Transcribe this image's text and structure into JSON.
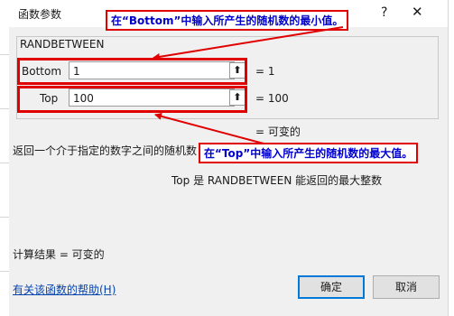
{
  "dialog": {
    "title": "函数参数",
    "help_glyph": "?",
    "close_glyph": "✕"
  },
  "function": {
    "name": "RANDBETWEEN",
    "args": [
      {
        "label": "Bottom",
        "value": "1",
        "result": "=  1"
      },
      {
        "label": "Top",
        "value": "100",
        "result": "=  100"
      }
    ],
    "formula_result": "=  可变的"
  },
  "description": {
    "main": "返回一个介于指定的数字之间的随机数",
    "arg_detail": "Top  是 RANDBETWEEN 能返回的最大整数"
  },
  "footer": {
    "calc_result": "计算结果 =   可变的",
    "help_link": "有关该函数的帮助(H)",
    "ok_label": "确定",
    "cancel_label": "取消"
  },
  "annotations": {
    "bottom_callout": "在“Bottom”中输入所产生的随机数的最小值。",
    "top_callout": "在“Top”中输入所产生的随机数的最大值。",
    "highlight_color": "#e00000",
    "callout_text_color": "#0000cc"
  },
  "icons": {
    "ref_button": "collapse-dialog-icon",
    "ref_glyph": "⬆"
  }
}
